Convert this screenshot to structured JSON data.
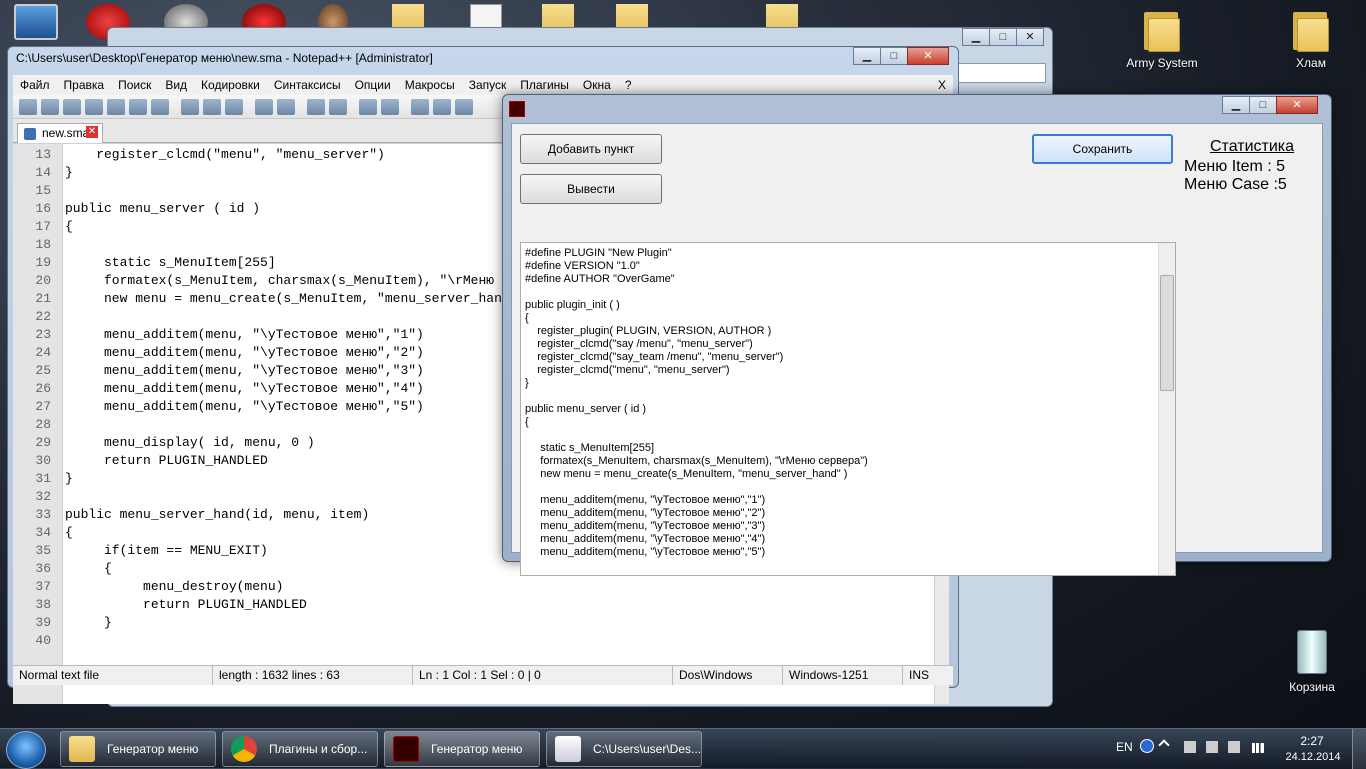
{
  "desktop": {
    "icons": [
      {
        "label": "Army System"
      },
      {
        "label": "Хлам"
      },
      {
        "label": "Корзина"
      }
    ]
  },
  "notepad": {
    "title": "C:\\Users\\user\\Desktop\\Генератор меню\\new.sma - Notepad++ [Administrator]",
    "menu": [
      "Файл",
      "Правка",
      "Поиск",
      "Вид",
      "Кодировки",
      "Синтаксисы",
      "Опции",
      "Макросы",
      "Запуск",
      "Плагины",
      "Окна",
      "?"
    ],
    "menu_close": "X",
    "tab": "new.sma",
    "lines": [
      {
        "n": "13",
        "t": "    register_clcmd(\"menu\", \"menu_server\")"
      },
      {
        "n": "14",
        "t": "}"
      },
      {
        "n": "15",
        "t": ""
      },
      {
        "n": "16",
        "t": "public menu_server ( id )"
      },
      {
        "n": "17",
        "t": "{"
      },
      {
        "n": "18",
        "t": ""
      },
      {
        "n": "19",
        "t": "     static s_MenuItem[255]"
      },
      {
        "n": "20",
        "t": "     formatex(s_MenuItem, charsmax(s_MenuItem), \"\\rМеню"
      },
      {
        "n": "21",
        "t": "     new menu = menu_create(s_MenuItem, \"menu_server_han"
      },
      {
        "n": "22",
        "t": ""
      },
      {
        "n": "23",
        "t": "     menu_additem(menu, \"\\yТестовое меню\",\"1\")"
      },
      {
        "n": "24",
        "t": "     menu_additem(menu, \"\\yТестовое меню\",\"2\")"
      },
      {
        "n": "25",
        "t": "     menu_additem(menu, \"\\yТестовое меню\",\"3\")"
      },
      {
        "n": "26",
        "t": "     menu_additem(menu, \"\\yТестовое меню\",\"4\")"
      },
      {
        "n": "27",
        "t": "     menu_additem(menu, \"\\yТестовое меню\",\"5\")"
      },
      {
        "n": "28",
        "t": ""
      },
      {
        "n": "29",
        "t": "     menu_display( id, menu, 0 )"
      },
      {
        "n": "30",
        "t": "     return PLUGIN_HANDLED"
      },
      {
        "n": "31",
        "t": "}"
      },
      {
        "n": "32",
        "t": ""
      },
      {
        "n": "33",
        "t": "public menu_server_hand(id, menu, item)"
      },
      {
        "n": "34",
        "t": "{"
      },
      {
        "n": "35",
        "t": "     if(item == MENU_EXIT)"
      },
      {
        "n": "36",
        "t": "     {"
      },
      {
        "n": "37",
        "t": "          menu_destroy(menu)"
      },
      {
        "n": "38",
        "t": "          return PLUGIN_HANDLED"
      },
      {
        "n": "39",
        "t": "     }"
      },
      {
        "n": "40",
        "t": ""
      }
    ],
    "status": {
      "type": "Normal text file",
      "length": "length : 1632    lines : 63",
      "pos": "Ln : 1    Col : 1    Sel : 0 | 0",
      "eol": "Dos\\Windows",
      "enc": "Windows-1251",
      "mode": "INS"
    }
  },
  "generator": {
    "add_button": "Добавить пункт",
    "output_button": "Вывести",
    "save_button": "Сохранить",
    "stats_title": "Статистика",
    "stat_item": "Меню Item : 5",
    "stat_case": "Меню Case :5",
    "code": [
      "#define PLUGIN \"New Plugin\"",
      "#define VERSION \"1.0\"",
      "#define AUTHOR \"OverGame\"",
      "",
      "public plugin_init ( )",
      "{",
      "    register_plugin( PLUGIN, VERSION, AUTHOR )",
      "    register_clcmd(\"say /menu\", \"menu_server\")",
      "    register_clcmd(\"say_team /menu\", \"menu_server\")",
      "    register_clcmd(\"menu\", \"menu_server\")",
      "}",
      "",
      "public menu_server ( id )",
      "{",
      "",
      "     static s_MenuItem[255]",
      "     formatex(s_MenuItem, charsmax(s_MenuItem), \"\\rМеню сервера\")",
      "     new menu = menu_create(s_MenuItem, \"menu_server_hand\" )",
      "",
      "     menu_additem(menu, \"\\yТестовое меню\",\"1\")",
      "     menu_additem(menu, \"\\yТестовое меню\",\"2\")",
      "     menu_additem(menu, \"\\yТестовое меню\",\"3\")",
      "     menu_additem(menu, \"\\yТестовое меню\",\"4\")",
      "     menu_additem(menu, \"\\yТестовое меню\",\"5\")"
    ]
  },
  "taskbar": {
    "items": [
      {
        "label": "Генератор меню"
      },
      {
        "label": "Плагины и сбор..."
      },
      {
        "label": "Генератор меню"
      },
      {
        "label": "C:\\Users\\user\\Des..."
      }
    ],
    "lang": "EN",
    "time": "2:27",
    "date": "24.12.2014"
  }
}
